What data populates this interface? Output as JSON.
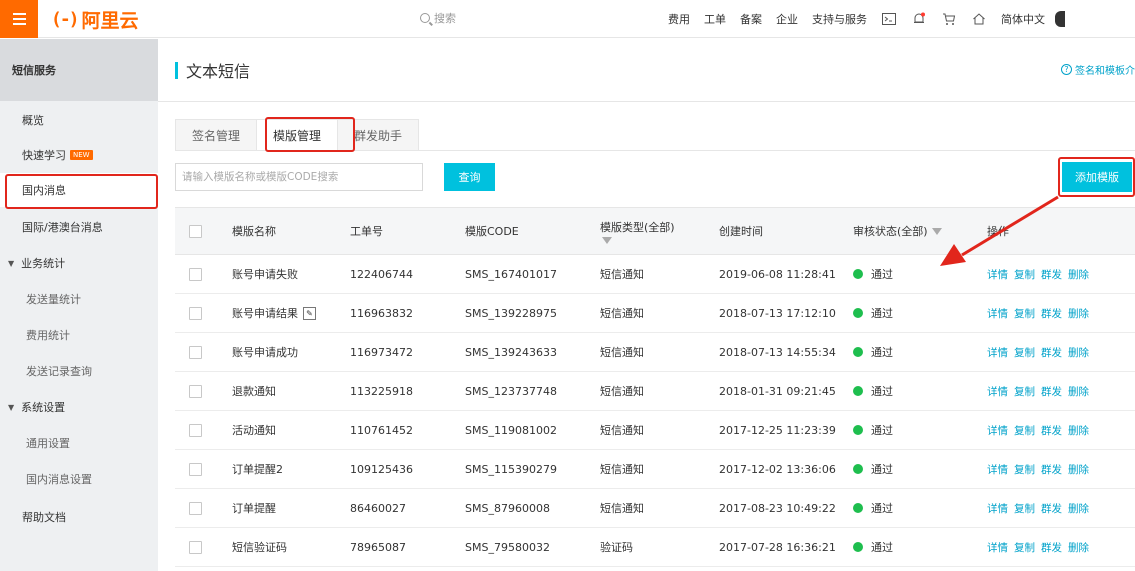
{
  "topbar": {
    "logo_mark": "(-)",
    "logo_text": "阿里云",
    "search_label": "搜索",
    "nav": [
      "费用",
      "工单",
      "备案",
      "企业",
      "支持与服务"
    ],
    "icons": [
      "terminal-icon",
      "bell-icon",
      "cart-icon",
      "home-icon"
    ],
    "language": "简体中文"
  },
  "sidebar": {
    "header": "短信服务",
    "items": [
      {
        "label": "概览"
      },
      {
        "label": "快速学习",
        "badge": "NEW"
      },
      {
        "label": "国内消息"
      },
      {
        "label": "国际/港澳台消息"
      },
      {
        "label": "业务统计"
      },
      {
        "label": "发送量统计"
      },
      {
        "label": "费用统计"
      },
      {
        "label": "发送记录查询"
      },
      {
        "label": "系统设置"
      },
      {
        "label": "通用设置"
      },
      {
        "label": "国内消息设置"
      },
      {
        "label": "帮助文档"
      }
    ]
  },
  "page": {
    "title": "文本短信",
    "help_link": "签名和模板介"
  },
  "tabs": [
    "签名管理",
    "模版管理",
    "群发助手"
  ],
  "search": {
    "placeholder": "请输入模版名称或模版CODE搜索",
    "query_label": "查询",
    "add_label": "添加模版"
  },
  "table": {
    "headers": {
      "name": "模版名称",
      "ticket": "工单号",
      "code": "模版CODE",
      "type": "模版类型(全部)",
      "created": "创建时间",
      "status": "审核状态(全部)",
      "ops": "操作"
    },
    "rows": [
      {
        "name": "账号申请失败",
        "ticket": "122406744",
        "code": "SMS_167401017",
        "type": "短信通知",
        "created": "2019-06-08 11:28:41",
        "status": "通过"
      },
      {
        "name": "账号申请结果",
        "ticket": "116963832",
        "code": "SMS_139228975",
        "type": "短信通知",
        "created": "2018-07-13 17:12:10",
        "status": "通过"
      },
      {
        "name": "账号申请成功",
        "ticket": "116973472",
        "code": "SMS_139243633",
        "type": "短信通知",
        "created": "2018-07-13 14:55:34",
        "status": "通过"
      },
      {
        "name": "退款通知",
        "ticket": "113225918",
        "code": "SMS_123737748",
        "type": "短信通知",
        "created": "2018-01-31 09:21:45",
        "status": "通过"
      },
      {
        "name": "活动通知",
        "ticket": "110761452",
        "code": "SMS_119081002",
        "type": "短信通知",
        "created": "2017-12-25 11:23:39",
        "status": "通过"
      },
      {
        "name": "订单提醒2",
        "ticket": "109125436",
        "code": "SMS_115390279",
        "type": "短信通知",
        "created": "2017-12-02 13:36:06",
        "status": "通过"
      },
      {
        "name": "订单提醒",
        "ticket": "86460027",
        "code": "SMS_87960008",
        "type": "短信通知",
        "created": "2017-08-23 10:49:22",
        "status": "通过"
      },
      {
        "name": "短信验证码",
        "ticket": "78965087",
        "code": "SMS_79580032",
        "type": "验证码",
        "created": "2017-07-28 16:36:21",
        "status": "通过"
      }
    ],
    "operations": [
      "详情",
      "复制",
      "群发",
      "删除"
    ]
  },
  "colors": {
    "brand": "#ff6a00",
    "accent": "#00c1de",
    "link": "#00a2ca",
    "status_ok": "#1ebe4e",
    "highlight": "#e1261c"
  }
}
